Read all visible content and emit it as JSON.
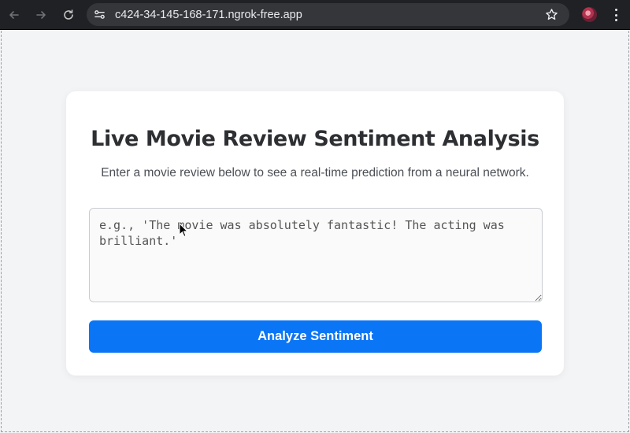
{
  "browser": {
    "url": "c424-34-145-168-171.ngrok-free.app",
    "icons": [
      "back-icon",
      "forward-icon",
      "reload-icon",
      "site-info-icon",
      "star-icon",
      "profile-avatar",
      "kebab-menu-icon"
    ]
  },
  "card": {
    "title": "Live Movie Review Sentiment Analysis",
    "subtitle": "Enter a movie review below to see a real-time prediction from a neural network.",
    "review": {
      "value": "",
      "placeholder": "e.g., 'The movie was absolutely fantastic! The acting was brilliant.'"
    },
    "analyze_label": "Analyze Sentiment"
  },
  "colors": {
    "button": "#0a75f5",
    "page_bg": "#f3f4f6",
    "card_bg": "#ffffff",
    "title": "#2d2f33"
  }
}
